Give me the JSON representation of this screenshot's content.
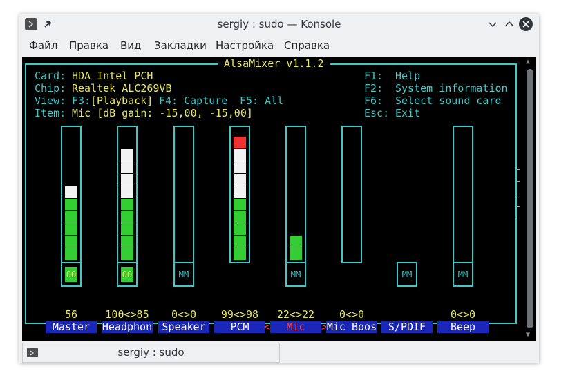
{
  "window": {
    "title": "sergiy : sudo — Konsole",
    "menu": [
      "Файл",
      "Правка",
      "Вид",
      "Закладки",
      "Настройка",
      "Справка"
    ],
    "tab_label": "sergiy : sudo"
  },
  "mixer": {
    "header": "AlsaMixer v1.1.2",
    "card_label": "Card:",
    "card_value": "HDA Intel PCH",
    "chip_label": "Chip:",
    "chip_value": "Realtek ALC269VB",
    "view_label": "View:",
    "view_f3_key": "F3:",
    "view_f3_value": "[Playback]",
    "view_f4": "F4: Capture",
    "view_f5": "F5: All",
    "item_label": "Item:",
    "item_value": "Mic [dB gain: -15,00, -15,00]",
    "keys": [
      {
        "key": "F1:",
        "desc": "Help"
      },
      {
        "key": "F2:",
        "desc": "System information"
      },
      {
        "key": "F6:",
        "desc": "Select sound card"
      },
      {
        "key": "Esc:",
        "desc": "Exit"
      }
    ],
    "selected_index": 4,
    "channels": [
      {
        "name": "Master",
        "volume": "56",
        "level": 0.56,
        "mute": "OO",
        "muted": false,
        "has_bar": true,
        "has_mute": true
      },
      {
        "name": "Headphon",
        "volume": "100<>85",
        "level": 0.85,
        "mute": "OO",
        "muted": false,
        "has_bar": true,
        "has_mute": true
      },
      {
        "name": "Speaker",
        "volume": "0<>0",
        "level": 0,
        "mute": "MM",
        "muted": true,
        "has_bar": true,
        "has_mute": true
      },
      {
        "name": "PCM",
        "volume": "99<>98",
        "level": 0.98,
        "mute": "",
        "muted": false,
        "has_bar": true,
        "has_mute": false
      },
      {
        "name": "Mic",
        "volume": "22<>22",
        "level": 0.22,
        "mute": "MM",
        "muted": true,
        "has_bar": true,
        "has_mute": true
      },
      {
        "name": "Mic Boos",
        "volume": "0<>0",
        "level": 0,
        "mute": "",
        "muted": false,
        "has_bar": true,
        "has_mute": false
      },
      {
        "name": "S/PDIF",
        "volume": "",
        "level": 0,
        "mute": "MM",
        "muted": true,
        "has_bar": false,
        "has_mute": true
      },
      {
        "name": "Beep",
        "volume": "0<>0",
        "level": 0,
        "mute": "MM",
        "muted": true,
        "has_bar": true,
        "has_mute": true
      }
    ],
    "selection_left": "<",
    "selection_right": ">"
  },
  "colors": {
    "frame": "#3fc8c8",
    "text_cyan": "#3fc8c8",
    "text_yellow": "#e8e860",
    "level_green": "#33cc33",
    "level_white": "#f2f2f2",
    "level_red": "#ee3333",
    "label_bg": "#1a26b8",
    "selected_label": "#ff4d4d"
  },
  "icons": [
    "konsole-app-icon",
    "pin-icon",
    "minimize-icon",
    "maximize-icon",
    "close-icon",
    "tab-terminal-icon"
  ]
}
